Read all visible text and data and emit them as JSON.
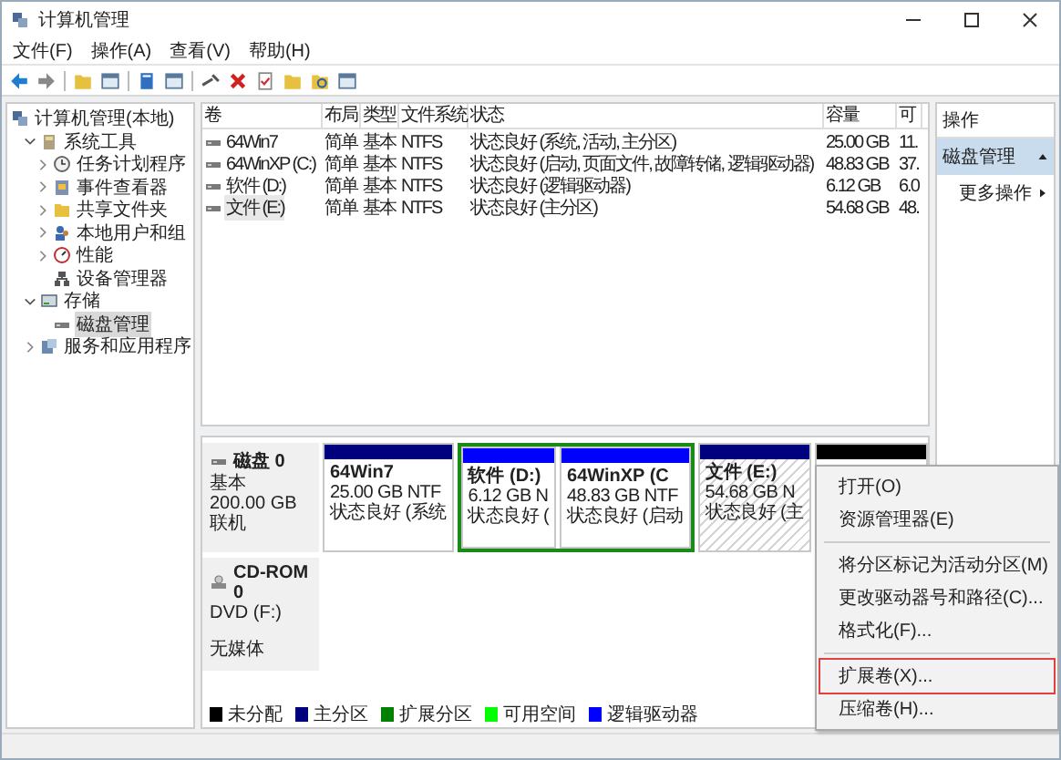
{
  "window": {
    "title": "计算机管理"
  },
  "menu_bar": [
    "文件(F)",
    "操作(A)",
    "查看(V)",
    "帮助(H)"
  ],
  "tree": [
    {
      "label": "计算机管理(本地)",
      "selected": false,
      "children": [
        {
          "label": "系统工具",
          "selected": false,
          "expanded": true,
          "children": [
            {
              "label": "任务计划程序",
              "selected": false,
              "expanded": false
            },
            {
              "label": "事件查看器",
              "selected": false,
              "expanded": false
            },
            {
              "label": "共享文件夹",
              "selected": false,
              "expanded": false
            },
            {
              "label": "本地用户和组",
              "selected": false,
              "expanded": false
            },
            {
              "label": "性能",
              "selected": false,
              "expanded": false
            },
            {
              "label": "设备管理器",
              "selected": false
            }
          ]
        },
        {
          "label": "存储",
          "selected": false,
          "expanded": true,
          "children": [
            {
              "label": "磁盘管理",
              "selected": true
            }
          ]
        },
        {
          "label": "服务和应用程序",
          "selected": false,
          "expanded": false
        }
      ]
    }
  ],
  "volumes": {
    "columns": [
      "卷",
      "布局",
      "类型",
      "文件系统",
      "状态",
      "容量",
      "可"
    ],
    "rows": [
      {
        "selected": false,
        "cells": [
          "64Win7",
          "简单",
          "基本",
          "NTFS",
          "状态良好 (系统, 活动, 主分区)",
          "25.00 GB",
          "11."
        ]
      },
      {
        "selected": false,
        "cells": [
          "64WinXP (C:)",
          "简单",
          "基本",
          "NTFS",
          "状态良好 (启动, 页面文件, 故障转储, 逻辑驱动器)",
          "48.83 GB",
          "37."
        ]
      },
      {
        "selected": false,
        "cells": [
          "软件 (D:)",
          "简单",
          "基本",
          "NTFS",
          "状态良好 (逻辑驱动器)",
          "6.12 GB",
          "6.0"
        ]
      },
      {
        "selected": true,
        "cells": [
          "文件 (E:)",
          "简单",
          "基本",
          "NTFS",
          "状态良好 (主分区)",
          "54.68 GB",
          "48."
        ]
      }
    ]
  },
  "disks": [
    {
      "kind": "basic",
      "name": "磁盘 0",
      "lines": [
        "基本",
        "200.00 GB",
        "联机"
      ],
      "partitions": [
        {
          "kind": "primary",
          "color": "#00007f",
          "selected": false,
          "name": "64Win7",
          "size": "25.00 GB NTF",
          "status": "状态良好 (系统"
        },
        {
          "kind": "extended",
          "children": [
            {
              "kind": "logical",
              "color": "#0000ff",
              "selected": false,
              "name": "软件  (D:)",
              "size": "6.12 GB N",
              "status": "状态良好 ("
            },
            {
              "kind": "logical",
              "color": "#0000ff",
              "selected": false,
              "name": "64WinXP  (C",
              "size": "48.83 GB NTF",
              "status": "状态良好 (启动"
            }
          ]
        },
        {
          "kind": "primary",
          "color": "#00007f",
          "selected": true,
          "name": "文件  (E:)",
          "size": "54.68 GB N",
          "status": "状态良好 (主"
        },
        {
          "kind": "unallocated",
          "color": "#000000",
          "selected": false
        }
      ]
    },
    {
      "kind": "cdrom",
      "name": "CD-ROM 0",
      "lines": [
        "DVD (F:)",
        "无媒体"
      ]
    }
  ],
  "legend": [
    {
      "label": "未分配",
      "color": "#000000"
    },
    {
      "label": "主分区",
      "color": "#00007f"
    },
    {
      "label": "扩展分区",
      "color": "#008000"
    },
    {
      "label": "可用空间",
      "color": "#00ff00"
    },
    {
      "label": "逻辑驱动器",
      "color": "#0000ff"
    }
  ],
  "actions": {
    "title": "操作",
    "section": {
      "label": "磁盘管理",
      "expanded": true
    },
    "items": [
      {
        "label": "更多操作"
      }
    ]
  },
  "context_menu": [
    {
      "kind": "item",
      "label": "打开(O)",
      "highlighted": false
    },
    {
      "kind": "item",
      "label": "资源管理器(E)",
      "highlighted": false
    },
    {
      "kind": "separator"
    },
    {
      "kind": "item",
      "label": "将分区标记为活动分区(M)",
      "highlighted": false
    },
    {
      "kind": "item",
      "label": "更改驱动器号和路径(C)...",
      "highlighted": false
    },
    {
      "kind": "item",
      "label": "格式化(F)...",
      "highlighted": false
    },
    {
      "kind": "separator"
    },
    {
      "kind": "item",
      "label": "扩展卷(X)...",
      "highlighted": true
    },
    {
      "kind": "item",
      "label": "压缩卷(H)...",
      "highlighted": false
    }
  ]
}
